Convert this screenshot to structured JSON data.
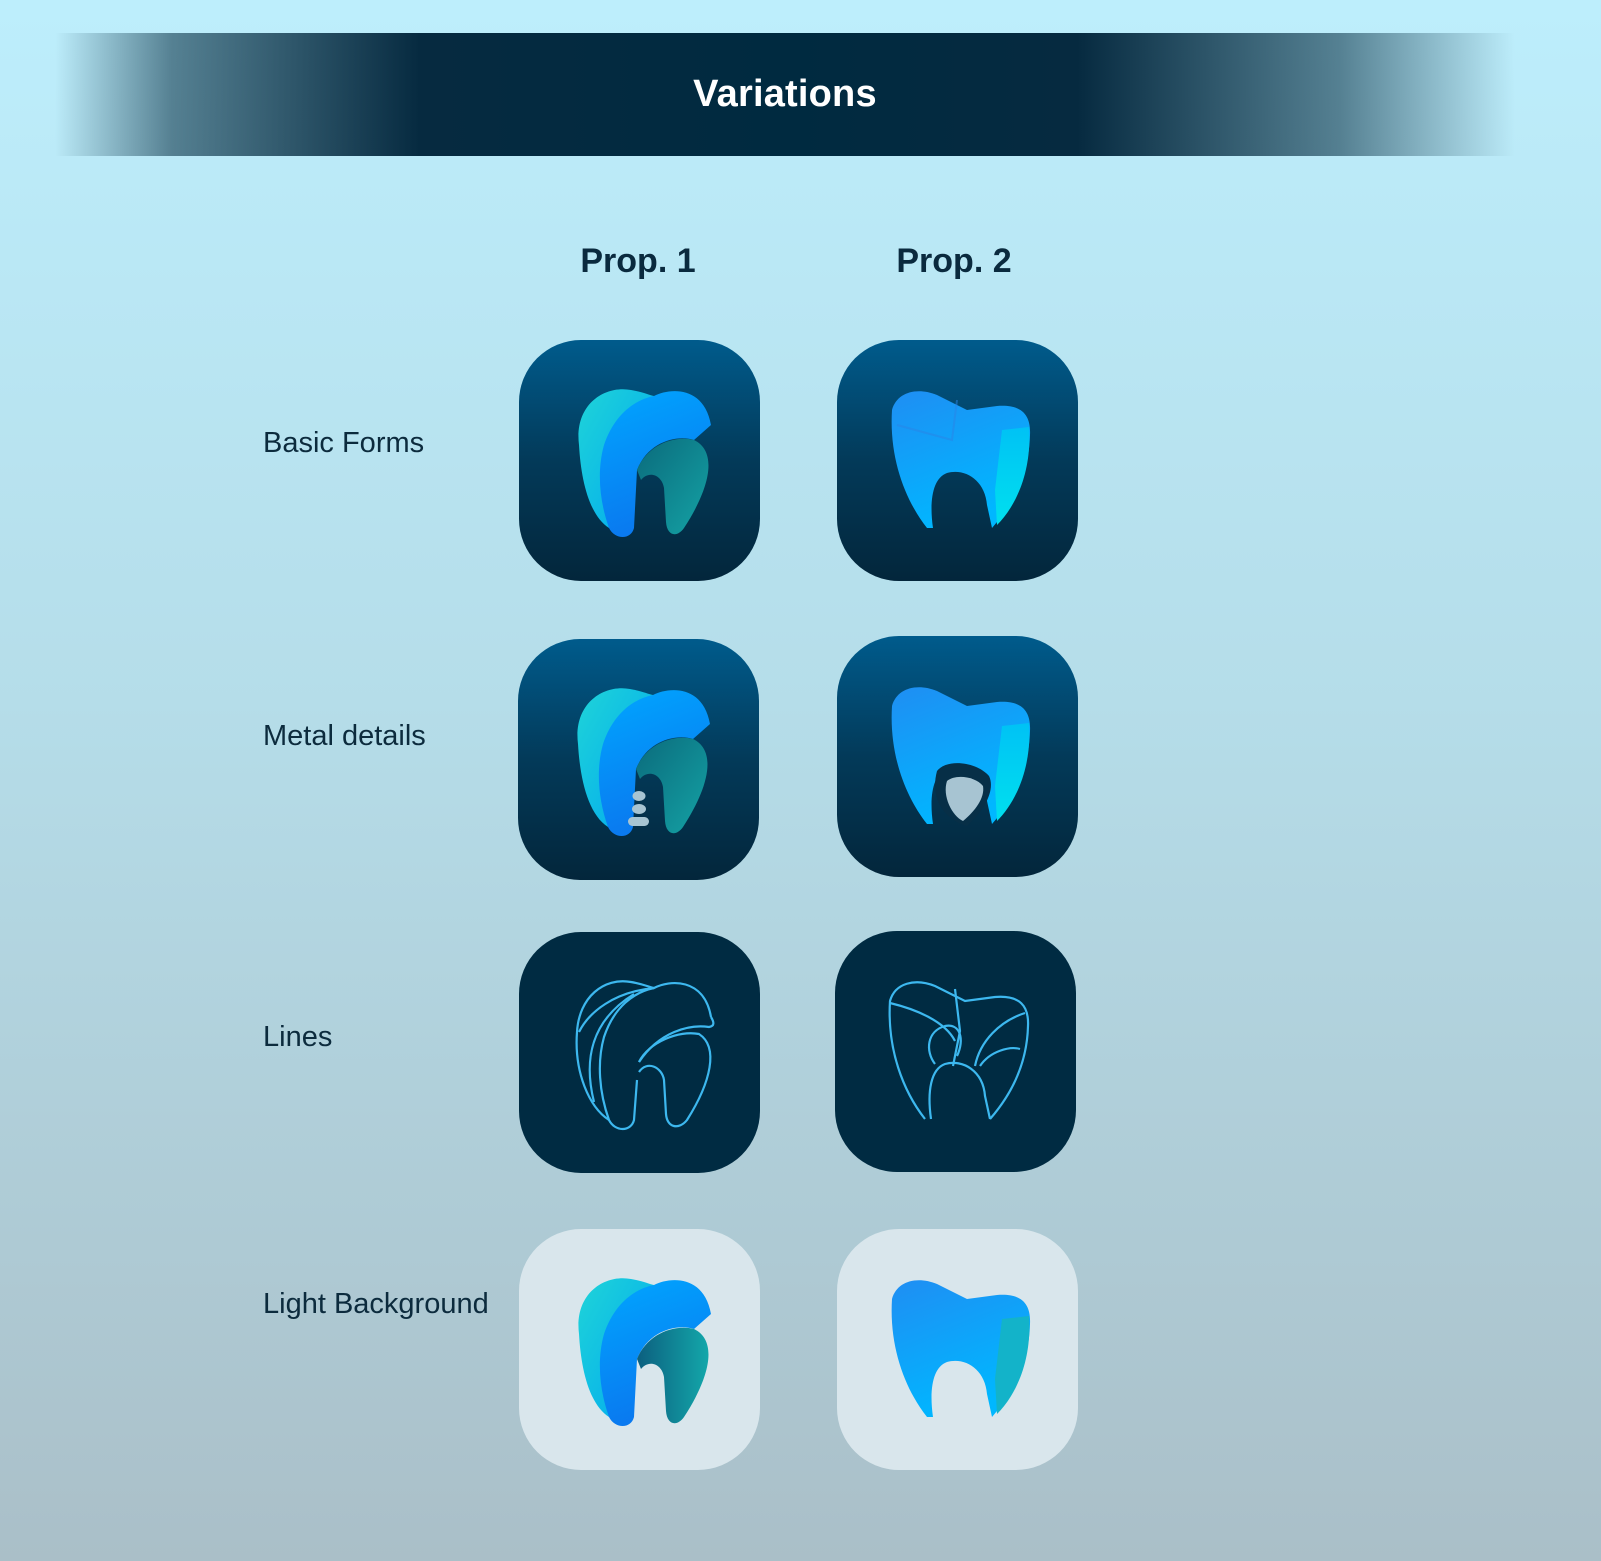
{
  "header": {
    "title": "Variations"
  },
  "columns": [
    {
      "label": "Prop. 1"
    },
    {
      "label": "Prop. 2"
    }
  ],
  "rows": [
    {
      "label": "Basic Forms"
    },
    {
      "label": "Metal details"
    },
    {
      "label": "Lines"
    },
    {
      "label": "Light Background"
    }
  ],
  "icons": [
    {
      "name": "tooth-prop1-basic-icon"
    },
    {
      "name": "tooth-prop2-basic-icon"
    },
    {
      "name": "tooth-prop1-metal-icon"
    },
    {
      "name": "tooth-prop2-metal-icon"
    },
    {
      "name": "tooth-prop1-lines-icon"
    },
    {
      "name": "tooth-prop2-lines-icon"
    },
    {
      "name": "tooth-prop1-light-icon"
    },
    {
      "name": "tooth-prop2-light-icon"
    }
  ],
  "colors": {
    "banner": "#002a40",
    "tile_gradient_top": "#005b8c",
    "tile_gradient_bottom": "#03263b",
    "tile_dark": "#002b42",
    "tile_light": "#d9e6ec",
    "tooth_blue": "#00a3ff",
    "tooth_cyan": "#00d2ef",
    "tooth_teal": "#0d8f98",
    "line_stroke": "#3db8ef",
    "metal": "#a7c4d2"
  }
}
